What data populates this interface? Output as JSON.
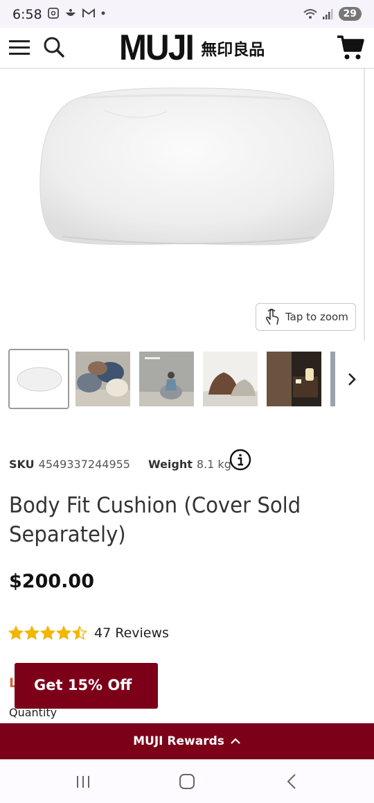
{
  "status_bar": {
    "time": "6:58",
    "battery": "29",
    "icons_left": [
      "screenshot-icon",
      "notification-icon",
      "gmail-icon",
      "dot-icon"
    ],
    "icons_right": [
      "wifi-icon",
      "signal-icon",
      "battery-icon"
    ]
  },
  "header": {
    "logo_text": "MUJI",
    "logo_kanji": "無印良品",
    "icons": [
      "menu-icon",
      "search-icon",
      "cart-icon"
    ]
  },
  "gallery": {
    "zoom_label": "Tap to zoom",
    "thumbnails": [
      "thumb-1",
      "thumb-2",
      "thumb-3",
      "thumb-4",
      "thumb-5",
      "thumb-6"
    ],
    "selected_index": 0
  },
  "product": {
    "sku_label": "SKU",
    "sku_value": "4549337244955",
    "weight_label": "Weight",
    "weight_value": "8.1 kg",
    "title": "Body Fit Cushion (Cover Sold Separately)",
    "price": "$200.00",
    "rating_value": 4.5,
    "rating_max": 5,
    "reviews": "47 Reviews",
    "hidden_label": "L",
    "quantity_label": "Quantity"
  },
  "promo": {
    "label": "Get 15% Off"
  },
  "rewards": {
    "label": "MUJI Rewards"
  },
  "colors": {
    "brand": "#7d0019",
    "star": "#f2b600",
    "bg": "#ffffff"
  }
}
